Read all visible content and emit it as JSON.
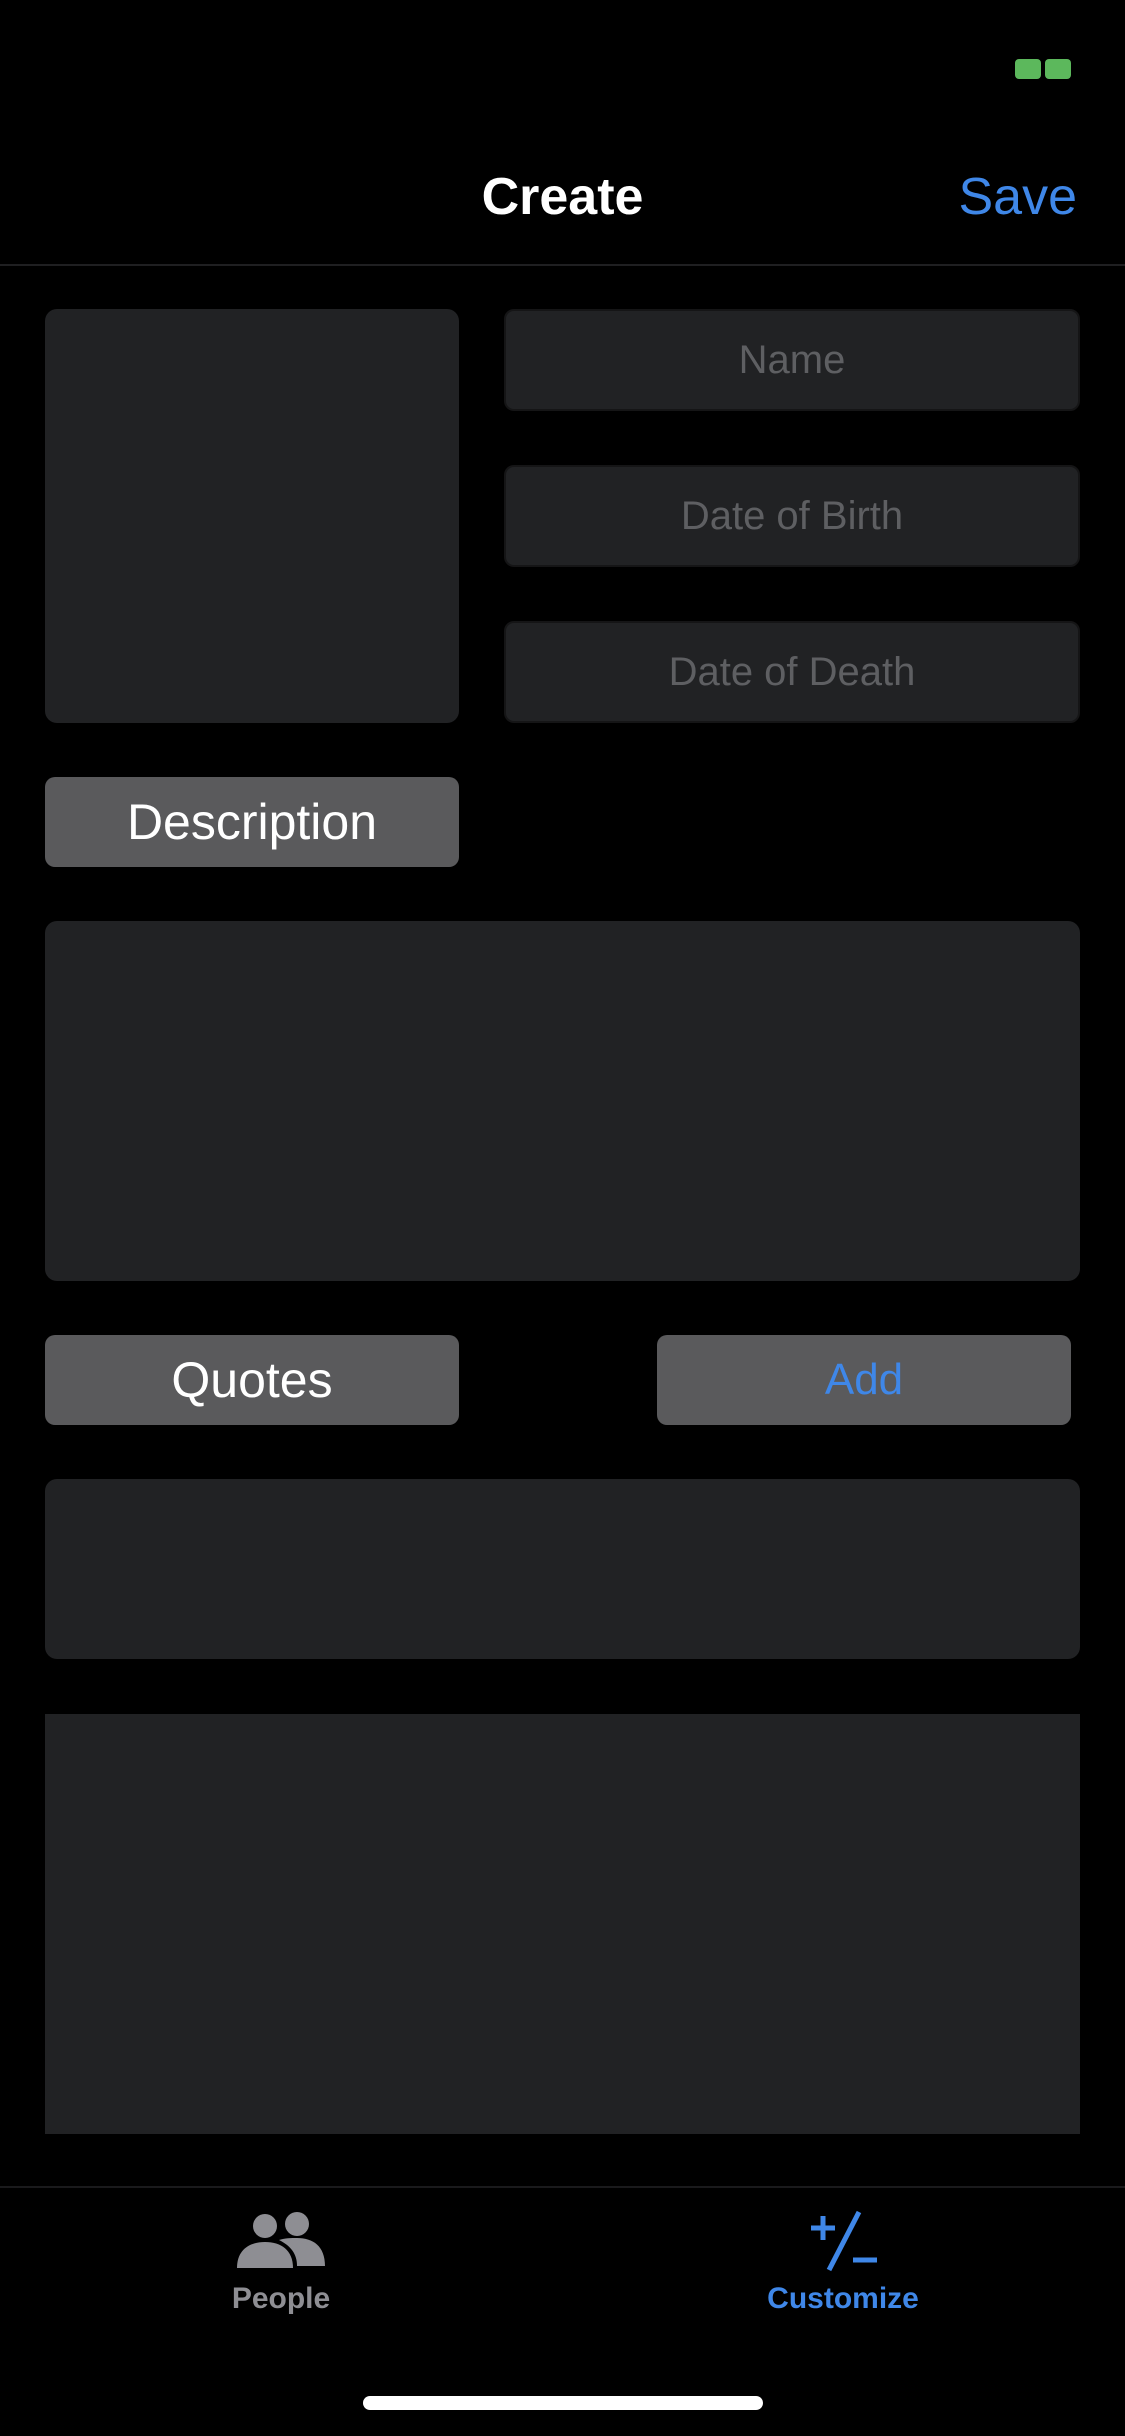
{
  "nav": {
    "title": "Create",
    "save_label": "Save"
  },
  "form": {
    "name_placeholder": "Name",
    "dob_placeholder": "Date of Birth",
    "dod_placeholder": "Date of Death",
    "description_label": "Description",
    "quotes_label": "Quotes",
    "add_label": "Add"
  },
  "tabbar": {
    "items": [
      {
        "label": "People",
        "icon": "people-icon",
        "selected": false
      },
      {
        "label": "Customize",
        "icon": "plus-minus-icon",
        "selected": true
      }
    ]
  },
  "colors": {
    "accent": "#3f87e8",
    "background": "#000000",
    "field": "#212224",
    "button": "#5a5a5c",
    "status_indicator": "#5cb85c"
  }
}
